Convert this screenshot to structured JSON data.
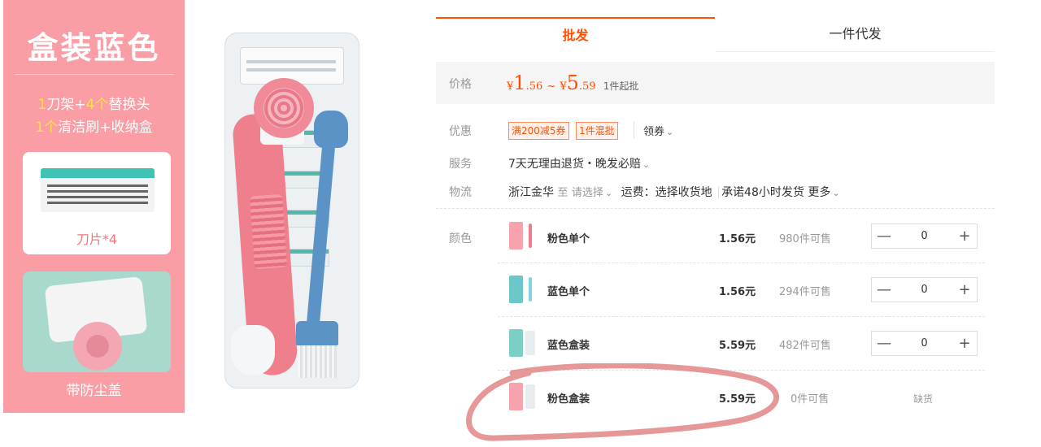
{
  "promo": {
    "title": "盒装蓝色",
    "line1": {
      "n1": "1",
      "t1": "刀架+",
      "n2": "4个",
      "t2": "替换头"
    },
    "line2": {
      "n1": "1个",
      "t1": "清洁刷+收纳盒"
    },
    "blade_label": "刀片*4",
    "dust_label": "带防尘盖"
  },
  "tabs": [
    {
      "label": "批发",
      "active": true
    },
    {
      "label": "一件代发",
      "active": false
    }
  ],
  "price": {
    "label": "价格",
    "low_currency": "¥",
    "low_int": "1",
    "low_dec": ".56",
    "sep": "~",
    "high_currency": "¥",
    "high_int": "5",
    "high_dec": ".59",
    "min_order": "1件起批"
  },
  "promo_info": {
    "label": "优惠",
    "badges": [
      "满200减5券",
      "1件混批"
    ],
    "coupon": "领券"
  },
  "service": {
    "label": "服务",
    "text": "7天无理由退货・晚发必赔"
  },
  "logistics": {
    "label": "物流",
    "from": "浙江金华",
    "to": "至",
    "to_select": "请选择",
    "fee": "运费：选择收货地",
    "promise": "承诺48小时发货",
    "more": "更多"
  },
  "variants": {
    "label": "颜色",
    "items": [
      {
        "name": "粉色单个",
        "price": "1.56元",
        "stock": "980件可售",
        "qty": "0",
        "minus": "—",
        "plus": "+"
      },
      {
        "name": "蓝色单个",
        "price": "1.56元",
        "stock": "294件可售",
        "qty": "0",
        "minus": "—",
        "plus": "+"
      },
      {
        "name": "蓝色盒装",
        "price": "5.59元",
        "stock": "482件可售",
        "qty": "0",
        "minus": "—",
        "plus": "+"
      },
      {
        "name": "粉色盒装",
        "price": "5.59元",
        "stock": "0件可售",
        "soldout": "缺货"
      }
    ]
  },
  "colors": {
    "accent": "#ff5000",
    "promo_bg": "#fa9da4",
    "highlight": "#ffe14a",
    "annotation": "#e38c8c"
  },
  "icons": [
    "chevron-down-icon",
    "minus-icon",
    "plus-icon"
  ]
}
